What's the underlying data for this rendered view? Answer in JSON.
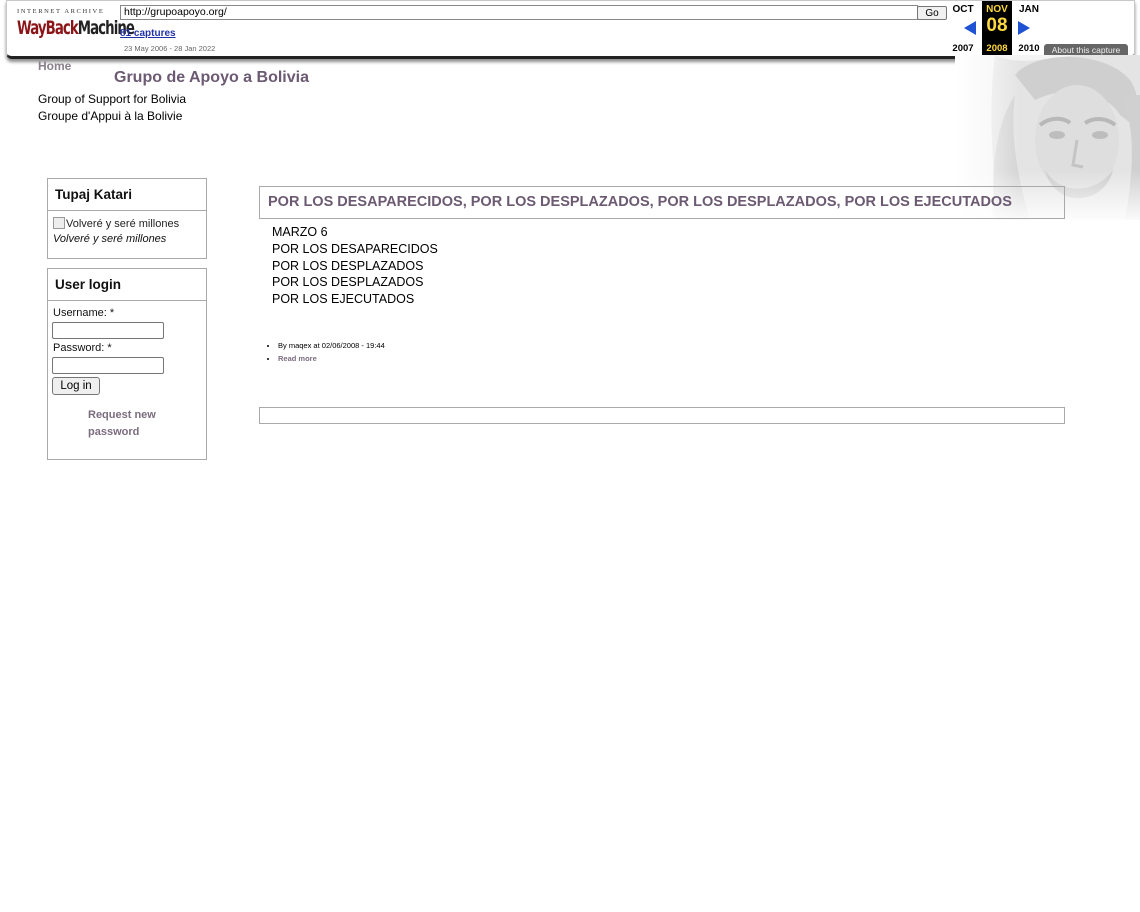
{
  "wayback": {
    "logo_top": "INTERNET ARCHIVE",
    "logo_main_a": "WayBack",
    "logo_main_b": "Machine",
    "url": "http://grupoapoyo.org/",
    "go_label": "Go",
    "captures": "81 captures",
    "date_range": "23 May 2006 - 28 Jan 2022",
    "calendar": {
      "prev_month": "OCT",
      "current_month": "NOV",
      "next_month": "JAN",
      "current_day": "08",
      "prev_year": "2007",
      "current_year": "2008",
      "next_year": "2010"
    },
    "about_label": "About this capture",
    "colors": {
      "logo_red": "#8a1417",
      "arrow_blue": "#1f53d4",
      "current_yellow": "#ffd93d"
    }
  },
  "site": {
    "logo_alt": "Home",
    "name": "Grupo de Apoyo a Bolivia",
    "slogan_en": "Group of Support for Bolivia",
    "slogan_fr": "Groupe d'Appui à la Bolivie",
    "accent_color": "#6b5a71"
  },
  "sidebar": {
    "katari": {
      "title": "Tupaj Katari",
      "image_alt": "Volveré y seré millones",
      "caption": "Volveré y seré millones"
    },
    "login": {
      "title": "User login",
      "username_label": "Username: *",
      "password_label": "Password: *",
      "username_value": "",
      "password_value": "",
      "submit_label": "Log in",
      "request_password": "Request new password"
    }
  },
  "main": {
    "node": {
      "title": "POR LOS DESAPARECIDOS, POR LOS DESPLAZADOS, POR LOS DESPLAZADOS, POR LOS EJECUTADOS",
      "body_lines": [
        "MARZO 6",
        "POR LOS DESAPARECIDOS",
        "POR LOS DESPLAZADOS",
        "POR LOS DESPLAZADOS",
        "POR LOS EJECUTADOS"
      ],
      "submitted": "By maqex at 02/06/2008 - 19:44",
      "read_more": "Read more"
    }
  }
}
